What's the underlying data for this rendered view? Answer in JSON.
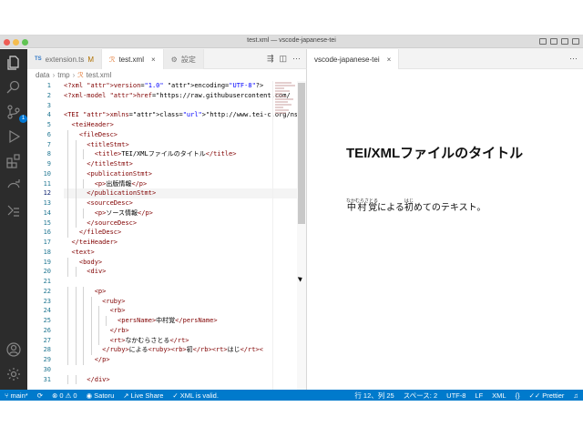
{
  "window": {
    "title": "test.xml — vscode-japanese-tei"
  },
  "tabs": [
    {
      "badge": "TS",
      "label": "extension.ts",
      "mod": "M"
    },
    {
      "label": "test.xml",
      "close": "×"
    },
    {
      "label": "設定"
    }
  ],
  "preview_tab": {
    "label": "vscode-japanese-tei",
    "close": "×"
  },
  "breadcrumb": [
    "data",
    "tmp",
    "test.xml"
  ],
  "activity": {
    "scm_badge": "1"
  },
  "editor": {
    "line_numbers": [
      "1",
      "2",
      "3",
      "4",
      "5",
      "6",
      "7",
      "8",
      "9",
      "10",
      "11",
      "12",
      "13",
      "14",
      "15",
      "16",
      "17",
      "18",
      "19",
      "20",
      "21",
      "22",
      "23",
      "24",
      "25",
      "26",
      "27",
      "28",
      "29",
      "30",
      "31"
    ],
    "lines": [
      "<?xml version=\"1.0\" encoding=\"UTF-8\"?>",
      "<?xml-model href=\"https://raw.githubusercontent.com/",
      "",
      "<TEI xmlns=\"http://www.tei-c.org/ns/1.0\">",
      "  <teiHeader>",
      "    <fileDesc>",
      "      <titleStmt>",
      "        <title>TEI/XMLファイルのタイトル</title>",
      "      </titleStmt>",
      "      <publicationStmt>",
      "        <p>出版情報</p>",
      "      </publicationStmt>",
      "      <sourceDesc>",
      "        <p>ソース情報</p>",
      "      </sourceDesc>",
      "    </fileDesc>",
      "  </teiHeader>",
      "  <text>",
      "    <body>",
      "      <div>",
      "",
      "        <p>",
      "          <ruby>",
      "            <rb>",
      "              <persName>中村覚</persName>",
      "            </rb>",
      "            <rt>なかむらさとる</rt>",
      "          </ruby>による<ruby><rb>初</rb><rt>はじ</rt><",
      "        </p>",
      "",
      "      </div>"
    ]
  },
  "preview": {
    "title": "TEI/XMLファイルのタイトル",
    "body": {
      "name_base": "中村覚",
      "name_ruby": "なかむらさとる",
      "mid": "による",
      "first_base": "初",
      "first_ruby": "はじ",
      "rest": "めてのテキスト。"
    }
  },
  "statusbar": {
    "branch": "main*",
    "problems": "⊗ 0 ⚠ 0",
    "user": "Satoru",
    "live_share": "Live Share",
    "xml_status": "XML is valid.",
    "position": "行 12、列 25",
    "spaces": "スペース: 2",
    "encoding": "UTF-8",
    "eol": "LF",
    "language": "XML",
    "prettier": "Prettier"
  }
}
